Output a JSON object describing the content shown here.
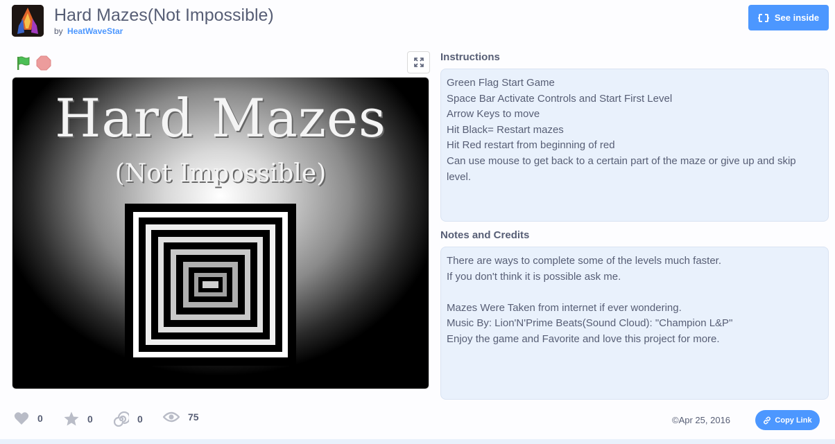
{
  "project": {
    "title": "Hard Mazes(Not Impossible)",
    "by_label": "by",
    "author": "HeatWaveStar",
    "see_inside_label": "See inside"
  },
  "stage": {
    "title_art": "Hard Mazes",
    "subtitle_art": "(Not Impossible)"
  },
  "instructions": {
    "heading": "Instructions",
    "lines": [
      "Green Flag Start Game",
      "Space Bar Activate Controls and Start First Level",
      "Arrow Keys to move",
      "Hit Black= Restart mazes",
      "Hit Red restart from beginning of red",
      "Can use mouse to get back to a certain part of the maze or give up and skip level."
    ]
  },
  "notes": {
    "heading": "Notes and Credits",
    "lines": [
      "There are ways to complete some of the levels much faster.",
      "If you don't think it is possible ask me.",
      "",
      "Mazes Were Taken from internet if ever wondering.",
      "Music By: Lion'N'Prime Beats(Sound Cloud): \"Champion L&P\"",
      "Enjoy the game and Favorite and love this project for more."
    ]
  },
  "stats": {
    "loves": "0",
    "favorites": "0",
    "remixes": "0",
    "views": "75"
  },
  "footer": {
    "date": "Apr 25, 2016",
    "copy_link_label": "Copy Link"
  },
  "colors": {
    "accent": "#4c97ff",
    "text": "#575e75",
    "box_bg": "#e9f1fc",
    "flag": "#4cbf56",
    "stop": "#ec9c9c"
  },
  "icons": [
    "see-inside-icon",
    "green-flag-icon",
    "stop-icon",
    "fullscreen-icon",
    "heart-icon",
    "star-icon",
    "remix-icon",
    "eye-icon",
    "copy-link-icon"
  ]
}
